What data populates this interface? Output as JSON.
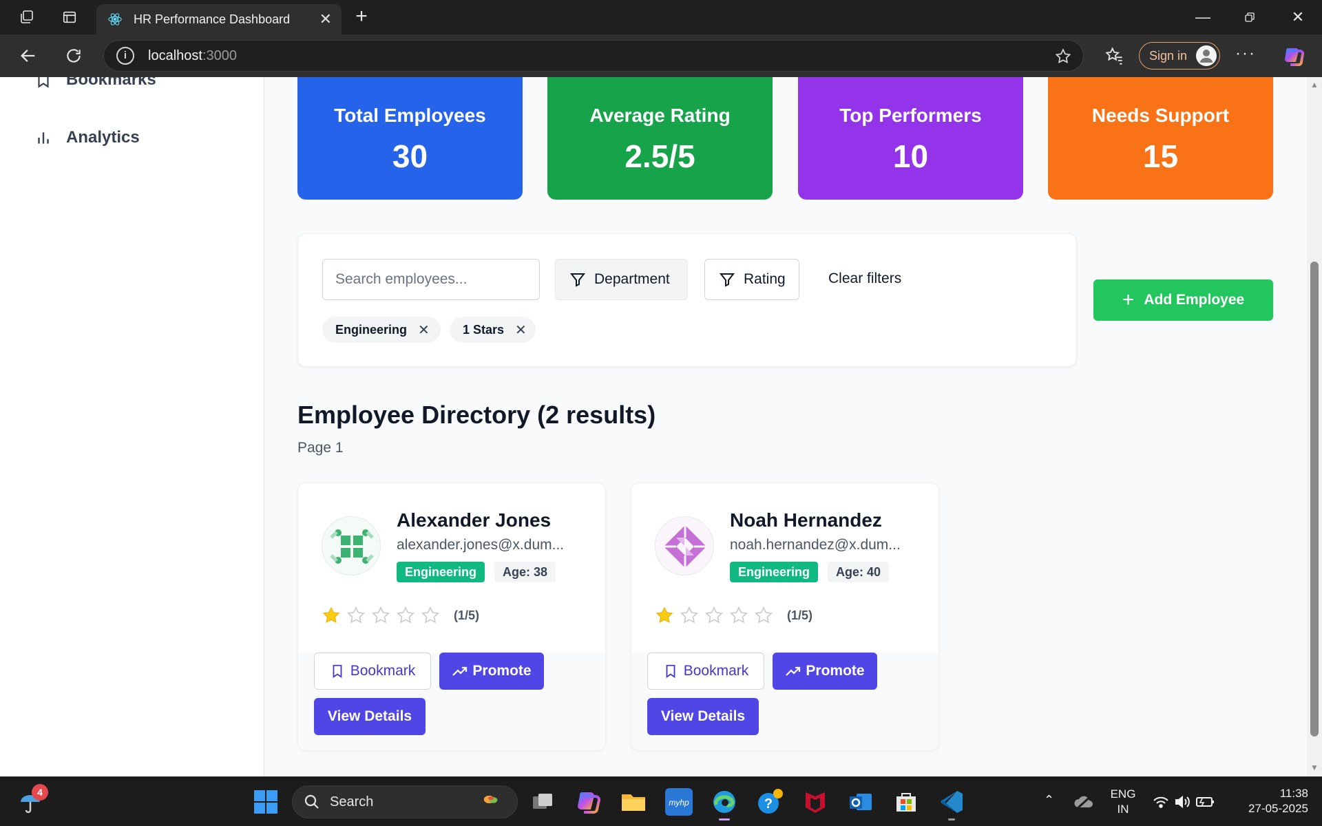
{
  "browser": {
    "tab_title": "HR Performance Dashboard",
    "url_host": "localhost",
    "url_port": ":3000",
    "sign_in_label": "Sign in"
  },
  "sidebar": {
    "items": [
      {
        "label": "Bookmarks",
        "icon": "bookmark-icon"
      },
      {
        "label": "Analytics",
        "icon": "bar-chart-icon"
      }
    ]
  },
  "stats": [
    {
      "label": "Total Employees",
      "value": "30",
      "color": "#2563eb"
    },
    {
      "label": "Average Rating",
      "value": "2.5/5",
      "color": "#16a34a"
    },
    {
      "label": "Top Performers",
      "value": "10",
      "color": "#9333ea"
    },
    {
      "label": "Needs Support",
      "value": "15",
      "color": "#f97316"
    }
  ],
  "filters": {
    "search_placeholder": "Search employees...",
    "search_value": "",
    "department_label": "Department",
    "rating_label": "Rating",
    "clear_label": "Clear filters",
    "chips": [
      {
        "label": "Engineering"
      },
      {
        "label": "1 Stars"
      }
    ]
  },
  "add_employee_label": "Add Employee",
  "directory": {
    "title": "Employee Directory (2 results)",
    "page": "Page 1"
  },
  "employees": [
    {
      "name": "Alexander Jones",
      "email": "alexander.jones@x.dum...",
      "department": "Engineering",
      "age": "Age: 38",
      "rating": 1,
      "rating_text": "(1/5)",
      "avatar_color": "#3cb371",
      "bookmark_label": "Bookmark",
      "promote_label": "Promote",
      "details_label": "View Details"
    },
    {
      "name": "Noah Hernandez",
      "email": "noah.hernandez@x.dum...",
      "department": "Engineering",
      "age": "Age: 40",
      "rating": 1,
      "rating_text": "(1/5)",
      "avatar_color": "#c470d6",
      "bookmark_label": "Bookmark",
      "promote_label": "Promote",
      "details_label": "View Details"
    }
  ],
  "taskbar": {
    "weather_badge": "4",
    "search_label": "Search",
    "lang_line1": "ENG",
    "lang_line2": "IN",
    "time": "11:38",
    "date": "27-05-2025"
  },
  "colors": {
    "accent": "#4f46e5",
    "success": "#22c55e",
    "star": "#facc15"
  }
}
